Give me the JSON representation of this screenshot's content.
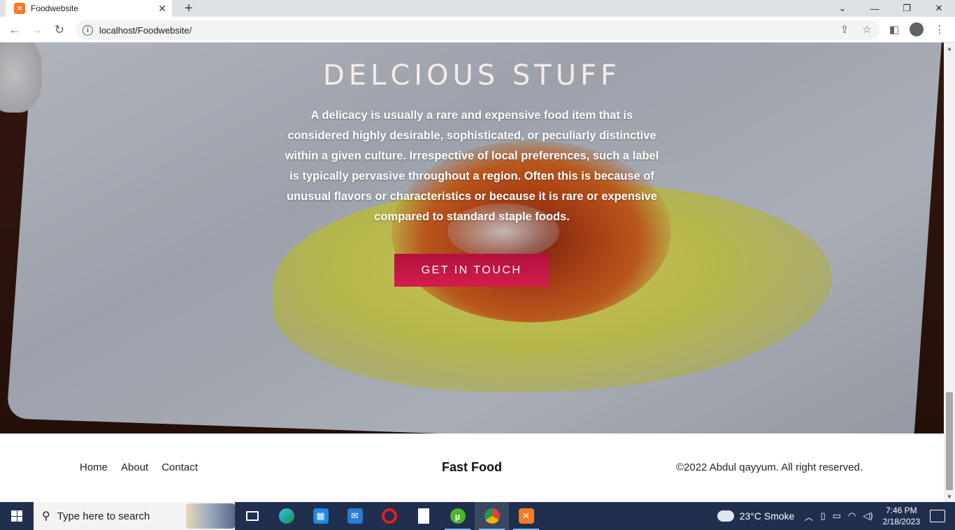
{
  "browser": {
    "tab_title": "Foodwebsite",
    "tab_favicon": "xampp-icon",
    "url": "localhost/Foodwebsite/"
  },
  "hero": {
    "title": "DELCIOUS STUFF",
    "text": "A delicacy is usually a rare and expensive food item that is considered highly desirable, sophisticated, or peculiarly distinctive within a given culture. Irrespective of local preferences, such a label is typically pervasive throughout a region. Often this is because of unusual flavors or characteristics or because it is rare or expensive compared to standard staple foods.",
    "cta_label": "GET IN TOUCH",
    "cta_color": "#c4174a"
  },
  "footer": {
    "nav": [
      "Home",
      "About",
      "Contact"
    ],
    "brand": "Fast Food",
    "copyright": "©2022 Abdul qayyum. All right reserved."
  },
  "taskbar": {
    "search_placeholder": "Type here to search",
    "weather": "23°C  Smoke",
    "time": "7:46 PM",
    "date": "2/18/2023"
  }
}
